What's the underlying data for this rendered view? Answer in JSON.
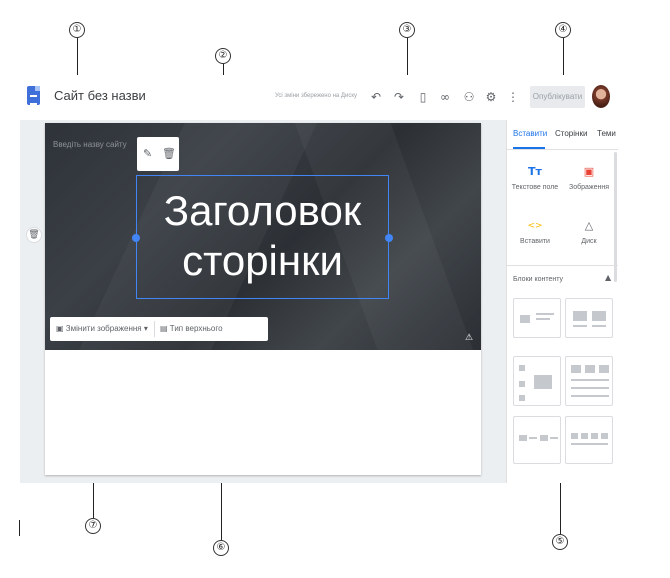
{
  "callouts": [
    "①",
    "②",
    "③",
    "④",
    "⑤",
    "⑥",
    "⑦"
  ],
  "app": {
    "title": "Сайт без назви",
    "save_status": "Усі зміни збережено на Диску",
    "publish_label": "Опублікувати"
  },
  "toolbar_icons": [
    "undo-icon",
    "redo-icon",
    "preview-icon",
    "link-icon",
    "share-icon",
    "settings-icon",
    "more-icon"
  ],
  "header": {
    "site_name_placeholder": "Введіть назву сайту",
    "title_line1": "Заголовок",
    "title_line2": "сторінки",
    "change_image_label": "Змінити зображення",
    "header_type_label": "Тип верхнього колонтитула"
  },
  "panel": {
    "tabs": [
      "Вставити",
      "Сторінки",
      "Теми"
    ],
    "active_tab": "Вставити",
    "insert_items": [
      {
        "label": "Текстове поле",
        "icon": "text-box-icon",
        "color": "#1a73e8"
      },
      {
        "label": "Зображення",
        "icon": "image-icon",
        "color": "#ea4335"
      },
      {
        "label": "Вставити",
        "icon": "embed-icon",
        "color": "#fbbc04"
      },
      {
        "label": "Диск",
        "icon": "drive-icon",
        "color": "#5f6368"
      }
    ],
    "section_label": "Блоки контенту"
  },
  "colors": {
    "accent": "#1a73e8",
    "selection": "#4285f4",
    "header_bg": "#33383d"
  }
}
